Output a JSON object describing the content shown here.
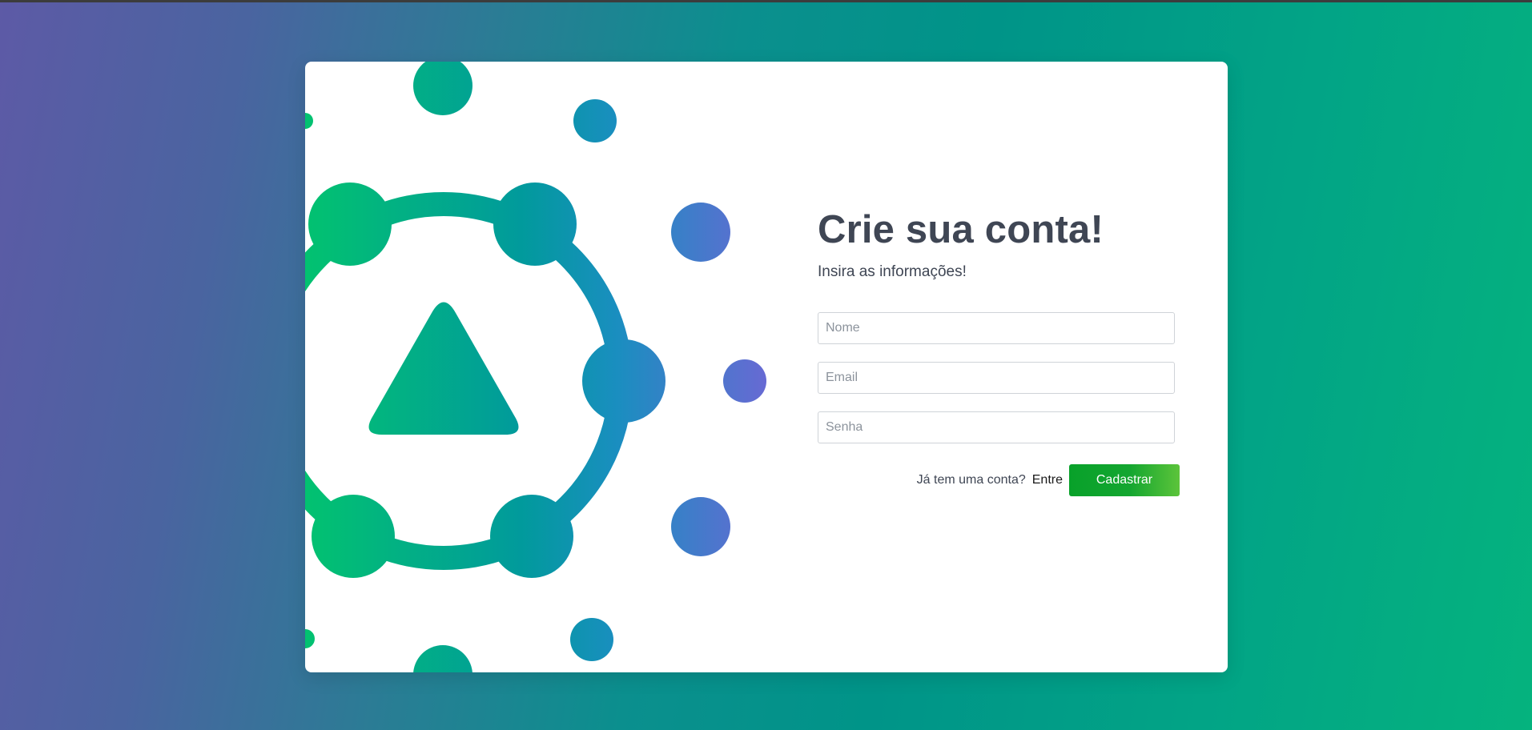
{
  "page": {
    "background_start": "#5d5aa6",
    "background_end": "#05b37e"
  },
  "signup": {
    "title": "Crie sua conta!",
    "subtitle": "Insira as informações!",
    "fields": {
      "name_placeholder": "Nome",
      "email_placeholder": "Email",
      "password_placeholder": "Senha"
    },
    "login_prompt": "Já tem uma conta?",
    "login_link": "Entre",
    "submit_label": "Cadastrar",
    "submit_color": "#08a12a"
  },
  "illustration": {
    "icon": "network-triangle-logo",
    "gradient_start": "#02c270",
    "gradient_end": "#7165d6"
  }
}
